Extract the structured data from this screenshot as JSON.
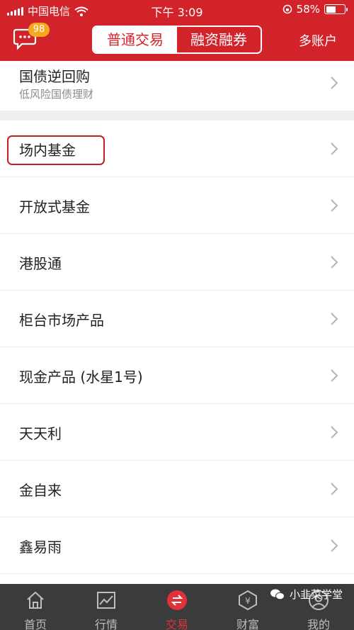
{
  "status_bar": {
    "carrier": "中国电信",
    "time": "下午 3:09",
    "battery": "58%",
    "battery_level": 0.58
  },
  "nav": {
    "badge_count": "98",
    "tabs": [
      {
        "label": "普通交易",
        "selected": true
      },
      {
        "label": "融资融券",
        "selected": false
      }
    ],
    "multi_account": "多账户"
  },
  "list": {
    "top_item": {
      "title": "国债逆回购",
      "subtitle": "低风险国债理财"
    },
    "items": [
      {
        "label": "场内基金",
        "highlighted": true
      },
      {
        "label": "开放式基金"
      },
      {
        "label": "港股通"
      },
      {
        "label": "柜台市场产品"
      },
      {
        "label": "现金产品 (水星1号)"
      },
      {
        "label": "天天利"
      },
      {
        "label": "金自来"
      },
      {
        "label": "鑫易雨"
      }
    ]
  },
  "tabbar": {
    "tabs": [
      {
        "label": "首页",
        "icon": "home-icon"
      },
      {
        "label": "行情",
        "icon": "chart-icon"
      },
      {
        "label": "交易",
        "icon": "trade-icon",
        "active": true
      },
      {
        "label": "财富",
        "icon": "wealth-icon"
      },
      {
        "label": "我的",
        "icon": "user-icon"
      }
    ]
  },
  "watermark": "小韭菜学堂",
  "colors": {
    "brand_red": "#d3232a",
    "badge_orange": "#f6a821",
    "tabbar_bg": "#3b3b3b"
  }
}
